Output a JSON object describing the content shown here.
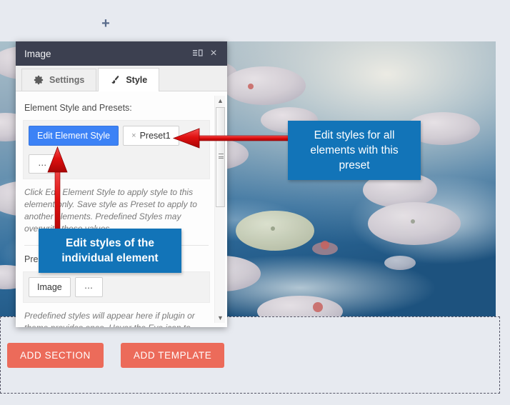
{
  "canvas": {
    "add_element_icon": "plus-icon",
    "hero_image_alt": "lily-pads-pond-photo"
  },
  "panel": {
    "title": "Image",
    "title_icons": [
      {
        "name": "layout-toggle-icon",
        "glyph": "☰"
      },
      {
        "name": "close-icon",
        "glyph": "×"
      }
    ],
    "tabs": [
      {
        "label": "Settings",
        "icon": "gear-icon",
        "active": false
      },
      {
        "label": "Style",
        "icon": "brush-icon",
        "active": true
      }
    ],
    "element_style_section": {
      "label": "Element Style and Presets:",
      "edit_element_style_button": "Edit Element Style",
      "preset_chip": {
        "remove_glyph": "×",
        "label": "Preset1"
      },
      "more_button": "…",
      "hint": "Click Edit Element Style to apply style to this element only. Save style as Preset to apply to another elements. Predefined Styles may overwrite these values."
    },
    "predefined_section": {
      "label": "Predefined Styles:",
      "image_button": "Image",
      "more_button": "…",
      "hint": "Predefined styles will appear here if plugin or theme provides ones. Hover the Eye icon to"
    },
    "scrollbar": {
      "up_glyph": "▲",
      "down_glyph": "▼"
    }
  },
  "annotations": [
    {
      "id": "preset",
      "text": "Edit styles for all elements with this preset",
      "color": "#1274b8"
    },
    {
      "id": "element",
      "text": "Edit styles of the individual element",
      "color": "#1274b8"
    }
  ],
  "footer": {
    "add_section_button": "ADD SECTION",
    "add_template_button": "ADD TEMPLATE"
  },
  "colors": {
    "accent_blue": "#3c82f6",
    "callout_blue": "#1274b8",
    "arrow_red": "#e81212",
    "add_button_red": "#ec6b5a",
    "panel_titlebar": "#3c4050",
    "page_bg": "#e7eaf0"
  }
}
